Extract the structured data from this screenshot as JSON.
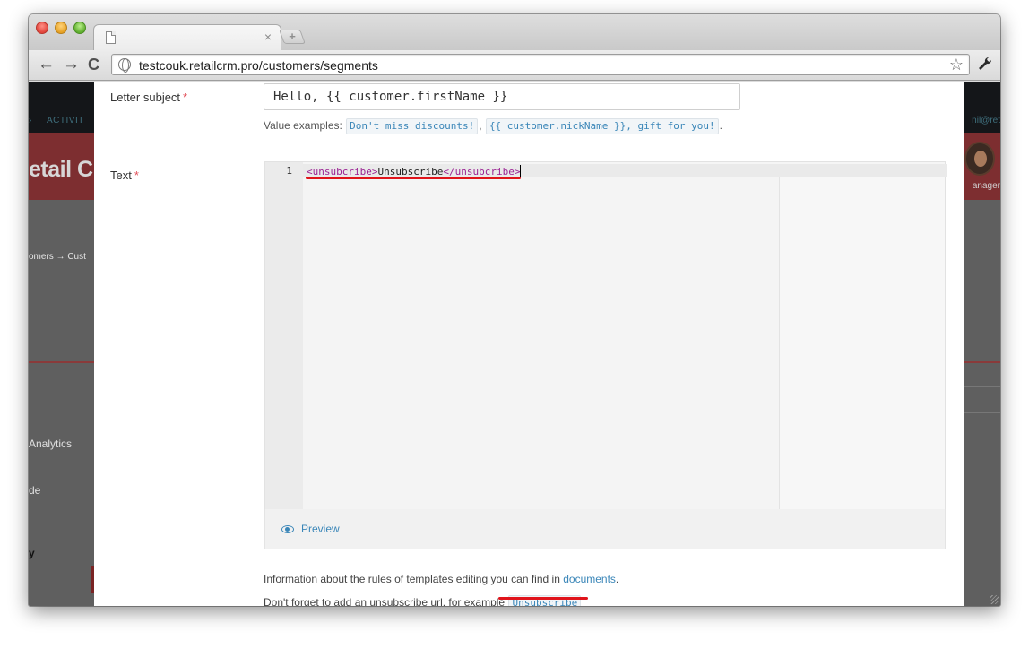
{
  "browser": {
    "tab_close": "×",
    "new_tab": "+",
    "url": "testcouk.retailcrm.pro/customers/segments",
    "nav": {
      "back": "←",
      "forward": "→",
      "reload": "C"
    },
    "star": "☆"
  },
  "background_app": {
    "top_link": "ACTIVIT",
    "top_caret": "›",
    "email_fragment": "nil@ret",
    "logo_fragment": "etail C",
    "user_role_fragment": "anager",
    "breadcrumb_fragment": "omers → Cust",
    "analytics_fragment": "Analytics",
    "de_fragment": "de",
    "y_fragment": "y"
  },
  "form": {
    "subject_label": "Letter subject",
    "required_mark": "*",
    "subject_value": "Hello, {{ customer.firstName }}",
    "examples_prefix": "Value examples:",
    "examples": [
      "Don't miss discounts!",
      "{{ customer.nickName }}, gift for you!"
    ],
    "examples_sep": ",",
    "examples_end": ".",
    "text_label": "Text",
    "editor": {
      "line_number": "1",
      "open_tag": "<unsubcribe>",
      "inner_text": "Unsubscribe",
      "close_tag": "</unsubcribe>"
    },
    "preview_label": "Preview",
    "info_text": "Information about the rules of templates editing you can find in",
    "info_link": "documents",
    "info_end": ".",
    "unsubscribe_text": "Don't forget to add an unsubscribe url, for example",
    "unsubscribe_chip": "Unsubscribe"
  },
  "colors": {
    "accent": "#3a86b8",
    "required": "#e2505a",
    "tag": "#9b2393",
    "annotation_underline": "#e0141b"
  }
}
